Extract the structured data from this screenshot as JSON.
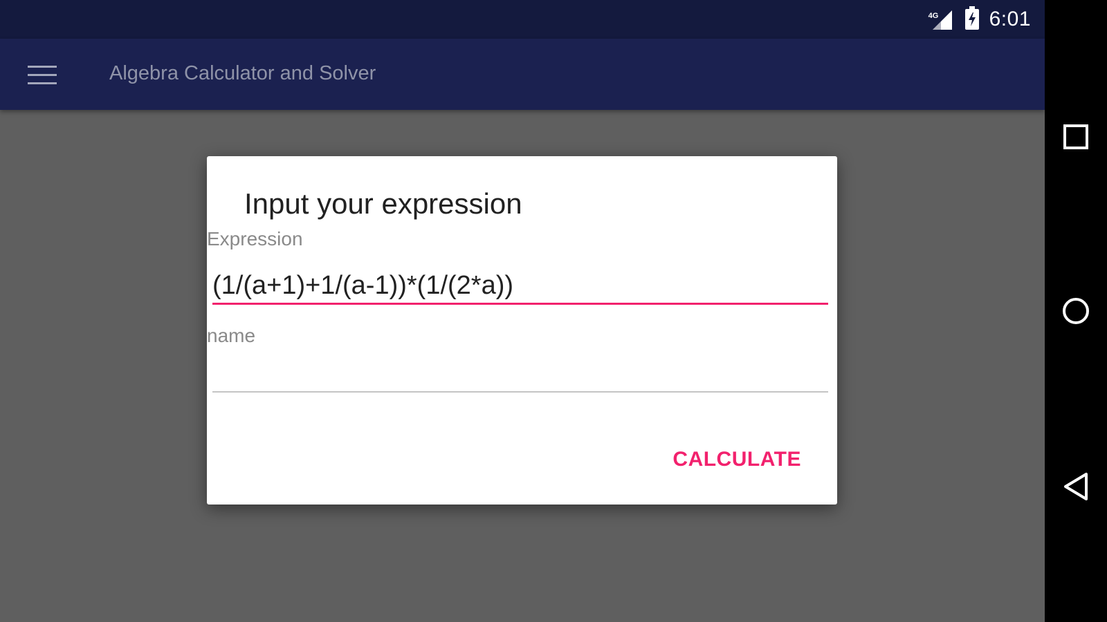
{
  "status_bar": {
    "network": "4G",
    "time": "6:01"
  },
  "app_bar": {
    "menu_icon": "hamburger-menu-icon",
    "title": "Algebra Calculator and Solver"
  },
  "dialog": {
    "title": "Input your expression",
    "expression_label": "Expression",
    "expression_value": "(1/(a+1)+1/(a-1))*(1/(2*a))",
    "name_label": "name",
    "name_value": "",
    "calculate_label": "CALCULATE"
  },
  "nav_bar": {
    "recents_icon": "square-recents-icon",
    "home_icon": "circle-home-icon",
    "back_icon": "triangle-back-icon"
  },
  "colors": {
    "status_bar": "#141a3e",
    "app_bar": "#1b2150",
    "accent": "#f2216d",
    "scrim": "#5f5f5f"
  }
}
